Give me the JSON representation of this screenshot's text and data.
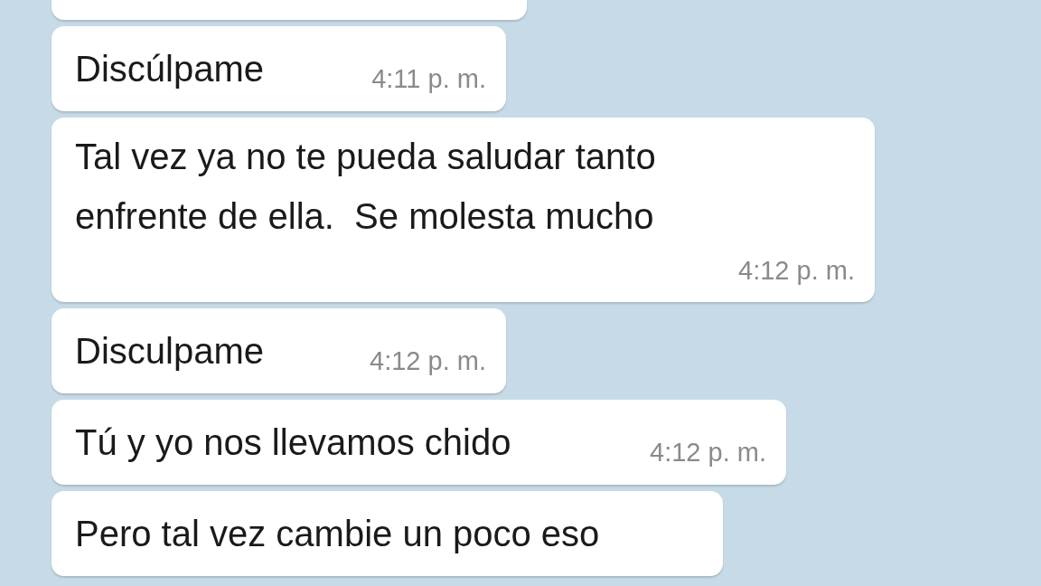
{
  "messages": [
    {
      "kind": "clipped"
    },
    {
      "kind": "message",
      "text": "Discúlpame",
      "time": "4:11 p. m."
    },
    {
      "kind": "message",
      "text": "Tal vez ya no te pueda saludar tanto enfrente de ella.  Se molesta mucho",
      "time": "4:12 p. m."
    },
    {
      "kind": "message",
      "text": "Disculpame",
      "time": "4:12 p. m."
    },
    {
      "kind": "message",
      "text": "Tú y yo nos llevamos chido",
      "time": "4:12 p. m."
    },
    {
      "kind": "message",
      "text": "Pero tal vez cambie un poco eso"
    }
  ]
}
